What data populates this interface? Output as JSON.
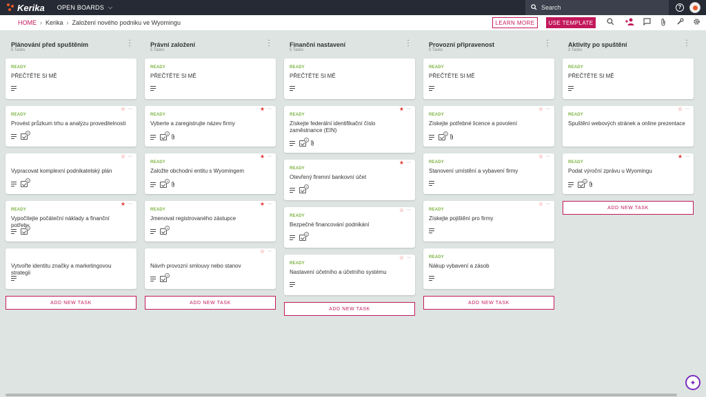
{
  "app": {
    "brand": "Kerika",
    "open_boards": "OPEN BOARDS",
    "search_placeholder": "Search"
  },
  "breadcrumb": {
    "home": "HOME",
    "org": "Kerika",
    "board": "Založení nového podniku ve Wyomingu"
  },
  "toolbar": {
    "learn_more": "LEARN MORE",
    "use_template": "USE TEMPLATE"
  },
  "add_task_label": "ADD NEW TASK",
  "columns": [
    {
      "title": "Plánování před spuštěním",
      "count": "5 Tasks",
      "cards": [
        {
          "status": "READY",
          "title": "PŘEČTĚTE SI MĚ",
          "star": "",
          "checklist": "",
          "attach": false,
          "lines": true
        },
        {
          "status": "READY",
          "title": "Provést průzkum trhu a analýzu proveditelnosti",
          "star": "empty",
          "checklist": "5",
          "attach": false,
          "lines": true
        },
        {
          "status": "",
          "title": "Vypracovat komplexní podnikatelský plán",
          "star": "empty",
          "checklist": "5",
          "attach": false,
          "lines": true
        },
        {
          "status": "READY",
          "title": "Vypočítejte počáteční náklady a finanční potřeby",
          "star": "filled",
          "checklist": "5",
          "attach": false,
          "lines": true
        },
        {
          "status": "",
          "title": "Vytvořte identitu značky a marketingovou strategii",
          "star": "",
          "checklist": "",
          "attach": false,
          "lines": true
        }
      ]
    },
    {
      "title": "Právní založení",
      "count": "5 Tasks",
      "cards": [
        {
          "status": "READY",
          "title": "PŘEČTĚTE SI MĚ",
          "star": "",
          "checklist": "",
          "attach": false,
          "lines": true
        },
        {
          "status": "READY",
          "title": "Vyberte a zaregistrujte název firmy",
          "star": "filled",
          "checklist": "4",
          "attach": true,
          "lines": true
        },
        {
          "status": "READY",
          "title": "Založte obchodní entitu s Wyomingem",
          "star": "filled",
          "checklist": "4",
          "attach": true,
          "lines": true
        },
        {
          "status": "READY",
          "title": "Jmenovat registrovaného zástupce",
          "star": "filled",
          "checklist": "4",
          "attach": false,
          "lines": true
        },
        {
          "status": "",
          "title": "Návrh provozní smlouvy nebo stanov",
          "star": "empty",
          "checklist": "4",
          "attach": false,
          "lines": true
        }
      ]
    },
    {
      "title": "Finanční nastavení",
      "count": "5 Tasks",
      "cards": [
        {
          "status": "READY",
          "title": "PŘEČTĚTE SI MĚ",
          "star": "",
          "checklist": "",
          "attach": false,
          "lines": true
        },
        {
          "status": "READY",
          "title": "Získejte federální identifikační číslo zaměstnance (EIN)",
          "star": "filled",
          "checklist": "4",
          "attach": true,
          "lines": true
        },
        {
          "status": "READY",
          "title": "Otevřený firemní bankovní účet",
          "star": "filled",
          "checklist": "5",
          "attach": false,
          "lines": true
        },
        {
          "status": "READY",
          "title": "Bezpečné financování podnikání",
          "star": "empty",
          "checklist": "5",
          "attach": false,
          "lines": true
        },
        {
          "status": "READY",
          "title": "Nastavení účetního a účetního systému",
          "star": "empty",
          "checklist": "",
          "attach": false,
          "lines": true
        }
      ]
    },
    {
      "title": "Provozní připravenost",
      "count": "5 Tasks",
      "cards": [
        {
          "status": "READY",
          "title": "PŘEČTĚTE SI MĚ",
          "star": "",
          "checklist": "",
          "attach": false,
          "lines": true
        },
        {
          "status": "READY",
          "title": "Získejte potřebné licence a povolení",
          "star": "empty",
          "checklist": "5",
          "attach": true,
          "lines": true
        },
        {
          "status": "READY",
          "title": "Stanovení umístění a vybavení firmy",
          "star": "empty",
          "checklist": "",
          "attach": false,
          "lines": true
        },
        {
          "status": "READY",
          "title": "Získejte pojištění pro firmy",
          "star": "empty",
          "checklist": "",
          "attach": false,
          "lines": true
        },
        {
          "status": "READY",
          "title": "Nákup vybavení a zásob",
          "star": "",
          "checklist": "",
          "attach": false,
          "lines": true
        }
      ]
    },
    {
      "title": "Aktivity po spuštění",
      "count": "3 Tasks",
      "cards": [
        {
          "status": "READY",
          "title": "PŘEČTĚTE SI MĚ",
          "star": "",
          "checklist": "",
          "attach": false,
          "lines": true
        },
        {
          "status": "READY",
          "title": "Spuštění webových stránek a online prezentace",
          "star": "empty",
          "checklist": "",
          "attach": false,
          "lines": false
        },
        {
          "status": "READY",
          "title": "Podat výroční zprávu u Wyomingu",
          "star": "filled",
          "checklist": "4",
          "attach": true,
          "lines": true
        }
      ]
    }
  ],
  "colors": {
    "accent": "#c2185b",
    "ready": "#7cb342",
    "topbar": "#262a35",
    "background": "#dde4e1"
  }
}
